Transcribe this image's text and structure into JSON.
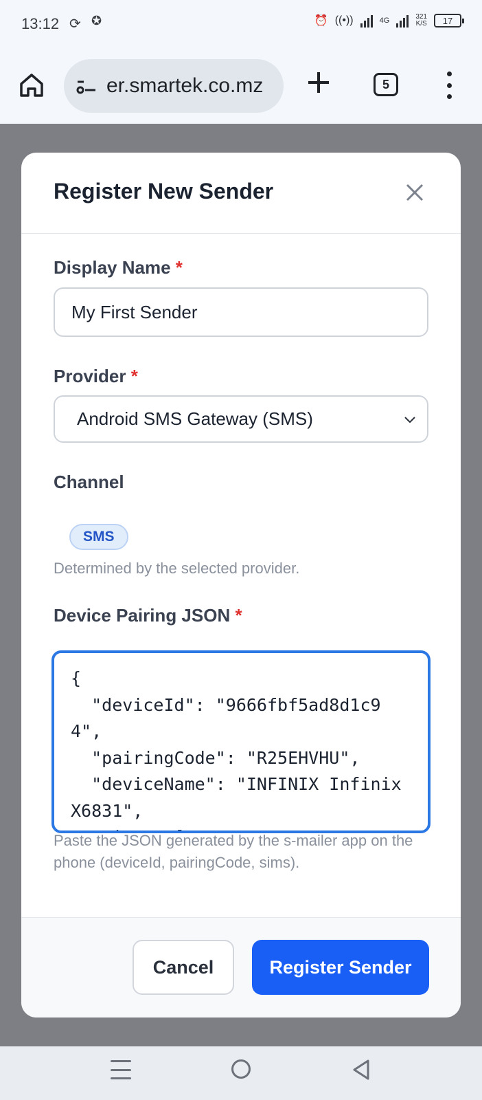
{
  "status_bar": {
    "time": "13:12",
    "network": "4G",
    "speed_value": "321",
    "speed_unit": "K/S",
    "battery": "17"
  },
  "browser": {
    "url": "er.smartek.co.mz",
    "tab_count": "5",
    "icons": [
      "home-icon",
      "site-settings-icon",
      "plus-icon",
      "tabs-icon",
      "more-vert-icon"
    ]
  },
  "modal": {
    "title": "Register New Sender",
    "display_name": {
      "label": "Display Name",
      "required_mark": "*",
      "value": "My First Sender"
    },
    "provider": {
      "label": "Provider",
      "required_mark": "*",
      "selected": "Android SMS Gateway (SMS)"
    },
    "channel": {
      "label": "Channel",
      "chip": "SMS",
      "hint": "Determined by the selected provider."
    },
    "device_json": {
      "label": "Device Pairing JSON",
      "required_mark": "*",
      "value": "{\n  \"deviceId\": \"9666fbf5ad8d1c94\",\n  \"pairingCode\": \"R25EHVHU\",\n  \"deviceName\": \"INFINIX Infinix X6831\",\n  \"sims\": [",
      "hint": "Paste the JSON generated by the s-mailer app on the phone (deviceId, pairingCode, sims)."
    },
    "buttons": {
      "cancel": "Cancel",
      "submit": "Register Sender"
    }
  },
  "colors": {
    "primary": "#1a5ff5",
    "focus_border": "#2b78e4",
    "required": "#e0322f",
    "overlay": "#7d7f84"
  }
}
